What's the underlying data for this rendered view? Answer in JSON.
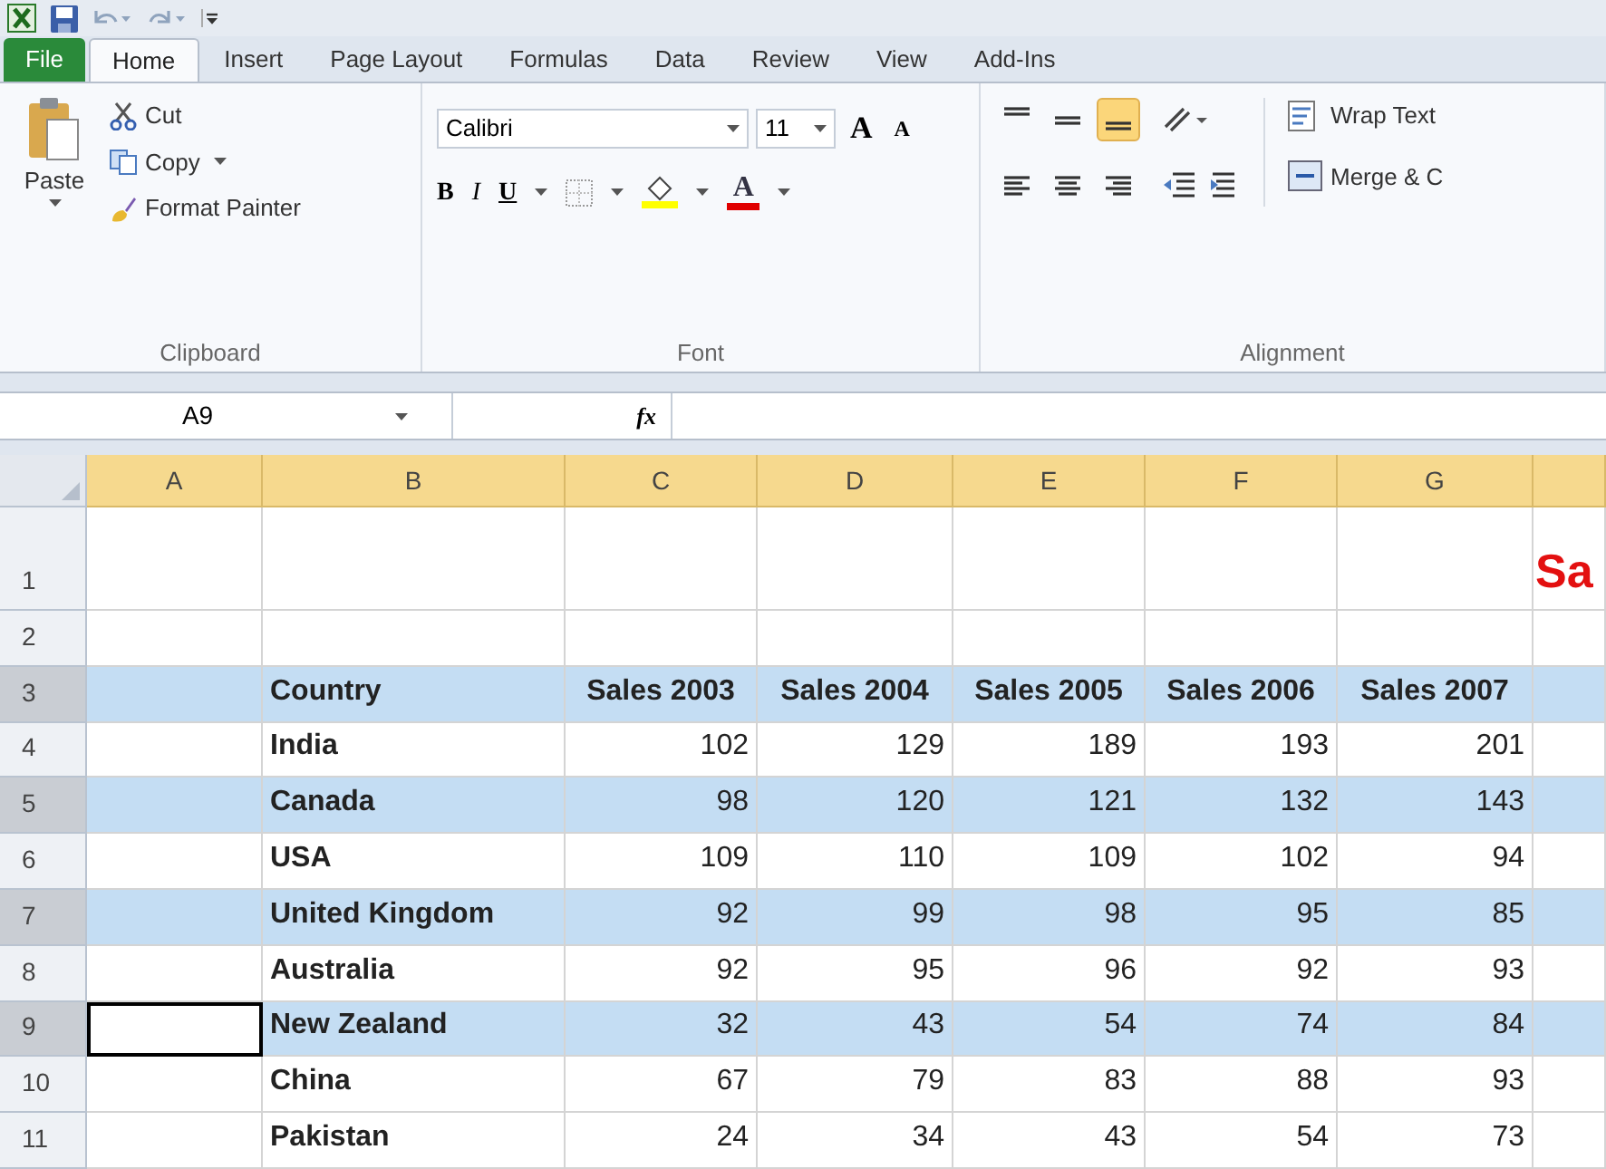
{
  "tabs": [
    {
      "label": "File",
      "kind": "file",
      "selected": false
    },
    {
      "label": "Home",
      "kind": "tab",
      "selected": true
    },
    {
      "label": "Insert",
      "kind": "tab",
      "selected": false
    },
    {
      "label": "Page Layout",
      "kind": "tab",
      "selected": false
    },
    {
      "label": "Formulas",
      "kind": "tab",
      "selected": false
    },
    {
      "label": "Data",
      "kind": "tab",
      "selected": false
    },
    {
      "label": "Review",
      "kind": "tab",
      "selected": false
    },
    {
      "label": "View",
      "kind": "tab",
      "selected": false
    },
    {
      "label": "Add-Ins",
      "kind": "tab",
      "selected": false
    }
  ],
  "clipboard": {
    "paste": "Paste",
    "cut": "Cut",
    "copy": "Copy",
    "format_painter": "Format Painter",
    "label": "Clipboard"
  },
  "font": {
    "name": "Calibri",
    "size": "11",
    "grow": "A",
    "shrink": "A",
    "bold": "B",
    "italic": "I",
    "underline": "U",
    "color_letter": "A",
    "label": "Font"
  },
  "alignment": {
    "buttons": [
      {
        "kind": "top",
        "selected": false
      },
      {
        "kind": "middle",
        "selected": false
      },
      {
        "kind": "bottom",
        "selected": true
      },
      {
        "kind": "left",
        "selected": false
      },
      {
        "kind": "center",
        "selected": false
      },
      {
        "kind": "right",
        "selected": false
      }
    ],
    "wrap_text": "Wrap Text",
    "merge": "Merge & C",
    "label": "Alignment"
  },
  "formula_bar": {
    "name_box": "A9",
    "fx": "fx"
  },
  "columns": [
    "A",
    "B",
    "C",
    "D",
    "E",
    "F",
    "G"
  ],
  "rows": [
    {
      "number": "1",
      "kind": "title",
      "banded": false,
      "selected_a": false,
      "title": "Sa"
    },
    {
      "number": "2",
      "kind": "data",
      "banded": false,
      "selected_a": false
    },
    {
      "number": "3",
      "kind": "header",
      "banded": true,
      "selected_a": false,
      "country": "Country",
      "values": [
        "Sales 2003",
        "Sales 2004",
        "Sales 2005",
        "Sales 2006",
        "Sales 2007"
      ]
    },
    {
      "number": "4",
      "kind": "data",
      "banded": false,
      "selected_a": false,
      "country": "India",
      "values": [
        "102",
        "129",
        "189",
        "193",
        "201"
      ]
    },
    {
      "number": "5",
      "kind": "data",
      "banded": true,
      "selected_a": false,
      "country": "Canada",
      "values": [
        "98",
        "120",
        "121",
        "132",
        "143"
      ]
    },
    {
      "number": "6",
      "kind": "data",
      "banded": false,
      "selected_a": false,
      "country": "USA",
      "values": [
        "109",
        "110",
        "109",
        "102",
        "94"
      ]
    },
    {
      "number": "7",
      "kind": "data",
      "banded": true,
      "selected_a": false,
      "country": "United Kingdom",
      "values": [
        "92",
        "99",
        "98",
        "95",
        "85"
      ]
    },
    {
      "number": "8",
      "kind": "data",
      "banded": false,
      "selected_a": false,
      "country": "Australia",
      "values": [
        "92",
        "95",
        "96",
        "92",
        "93"
      ]
    },
    {
      "number": "9",
      "kind": "data",
      "banded": true,
      "selected_a": true,
      "country": "New Zealand",
      "values": [
        "32",
        "43",
        "54",
        "74",
        "84"
      ]
    },
    {
      "number": "10",
      "kind": "data",
      "banded": false,
      "selected_a": false,
      "country": "China",
      "values": [
        "67",
        "79",
        "83",
        "88",
        "93"
      ]
    },
    {
      "number": "11",
      "kind": "data",
      "banded": false,
      "selected_a": false,
      "country": "Pakistan",
      "values": [
        "24",
        "34",
        "43",
        "54",
        "73"
      ]
    }
  ]
}
